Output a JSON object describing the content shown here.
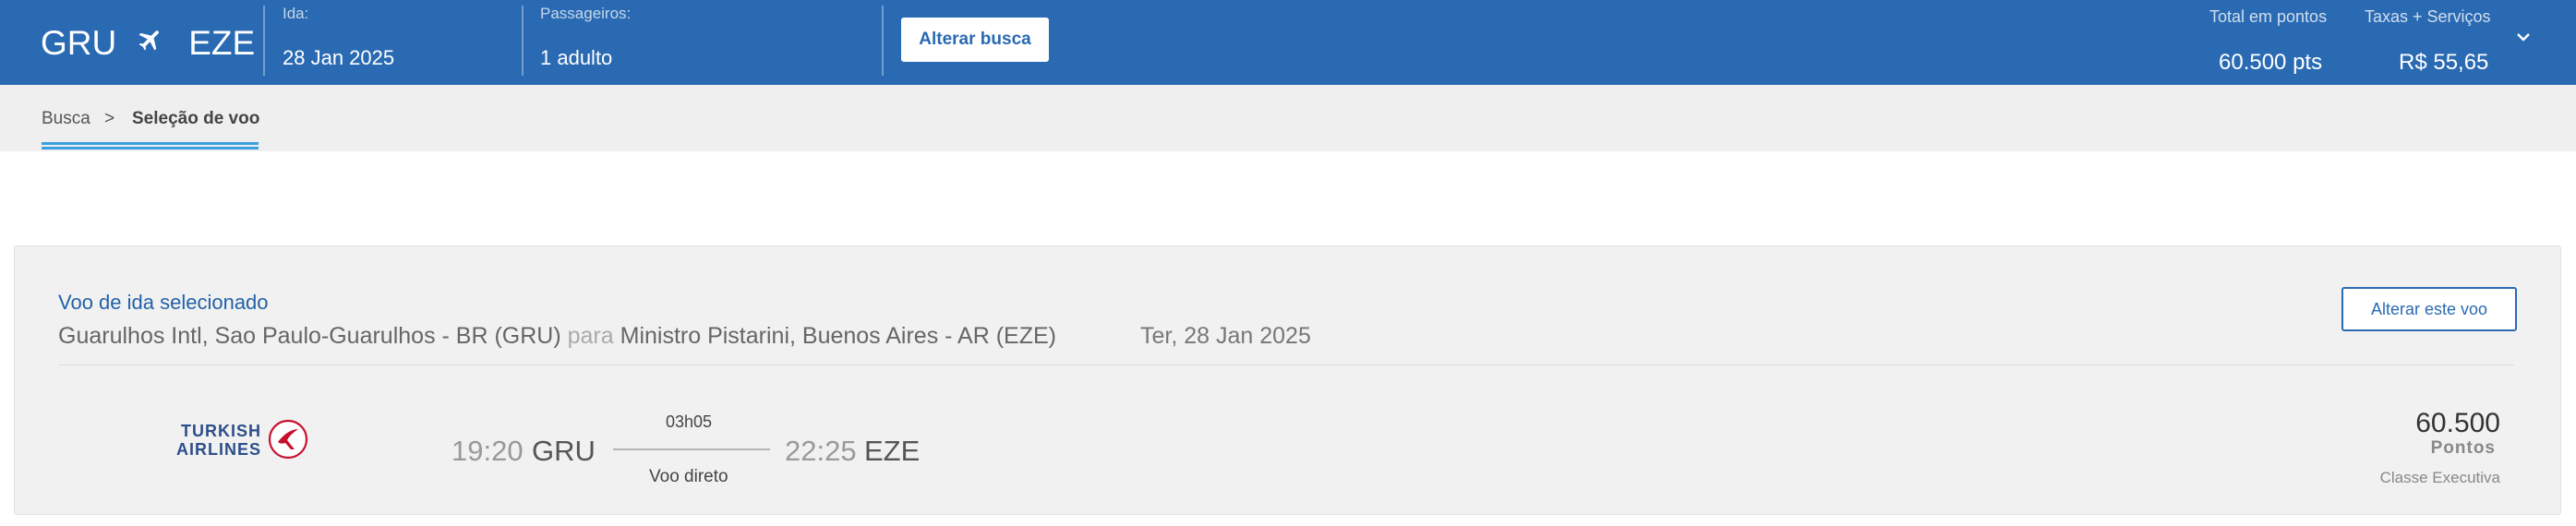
{
  "header": {
    "origin": "GRU",
    "destination": "EZE",
    "plane_icon": "airplane-icon",
    "departure_label": "Ida:",
    "departure_date": "28 Jan 2025",
    "passengers_label": "Passageiros:",
    "passengers_value": "1 adulto",
    "change_search_label": "Alterar busca",
    "total_points_label": "Total em pontos",
    "total_points_value": "60.500 pts",
    "fees_label": "Taxas + Serviços",
    "fees_value": "R$ 55,65",
    "expand_icon": "chevron-down-icon",
    "bar_color": "#2a6ab3"
  },
  "breadcrumb": {
    "items": [
      {
        "label": "Busca"
      },
      {
        "label": "Seleção de voo"
      }
    ],
    "separator": ">",
    "active_color": "#3aa0e0"
  },
  "selected_flight": {
    "title": "Voo de ida selecionado",
    "origin_full": "Guarulhos Intl, Sao Paulo-Guarulhos - BR (GRU)",
    "connector": "para",
    "destination_full": "Ministro Pistarini, Buenos Aires - AR (EZE)",
    "date": "Ter, 28 Jan 2025",
    "change_flight_label": "Alterar este voo",
    "airline": {
      "name_line1": "TURKISH",
      "name_line2": "AIRLINES",
      "logo_icon": "turkish-airlines-logo-icon"
    },
    "departure_time": "19:20",
    "departure_code": "GRU",
    "duration": "03h05",
    "stops": "Voo direto",
    "arrival_time": "22:25",
    "arrival_code": "EZE",
    "points": "60.500",
    "points_unit": "Pontos",
    "cabin_class": "Classe Executiva"
  }
}
